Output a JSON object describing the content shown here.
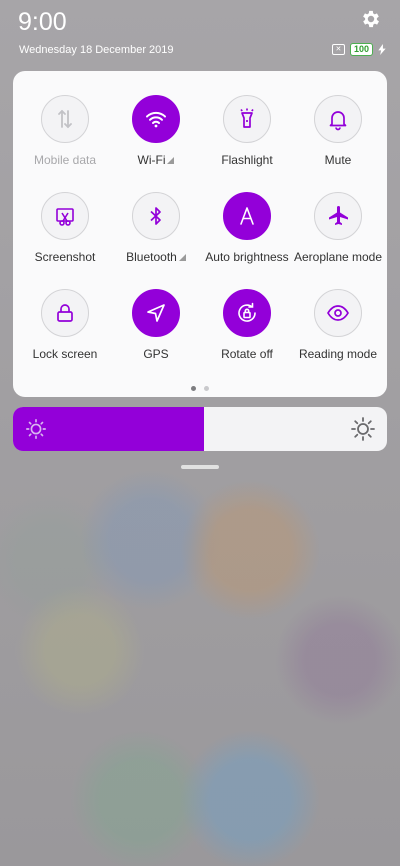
{
  "status": {
    "time": "9:00",
    "date": "Wednesday 18 December 2019",
    "battery": "100"
  },
  "tiles": [
    {
      "label": "Mobile data",
      "state": "unavailable",
      "icon": "mobile-data-icon"
    },
    {
      "label": "Wi-Fi",
      "state": "on",
      "icon": "wifi-icon"
    },
    {
      "label": "Flashlight",
      "state": "off",
      "icon": "flashlight-icon"
    },
    {
      "label": "Mute",
      "state": "off",
      "icon": "bell-icon"
    },
    {
      "label": "Screenshot",
      "state": "off",
      "icon": "screenshot-icon"
    },
    {
      "label": "Bluetooth",
      "state": "off",
      "icon": "bluetooth-icon"
    },
    {
      "label": "Auto brightness",
      "state": "on",
      "icon": "auto-brightness-icon"
    },
    {
      "label": "Aeroplane mode",
      "state": "off",
      "icon": "airplane-icon"
    },
    {
      "label": "Lock screen",
      "state": "off",
      "icon": "lock-icon"
    },
    {
      "label": "GPS",
      "state": "on",
      "icon": "location-icon"
    },
    {
      "label": "Rotate off",
      "state": "on",
      "icon": "rotation-lock-icon"
    },
    {
      "label": "Reading mode",
      "state": "off",
      "icon": "eye-icon"
    }
  ],
  "pager": {
    "pages": 2,
    "current": 1
  },
  "brightness": {
    "level": 0.51
  },
  "colors": {
    "accent": "#9300d9",
    "panel": "#fafafb"
  }
}
